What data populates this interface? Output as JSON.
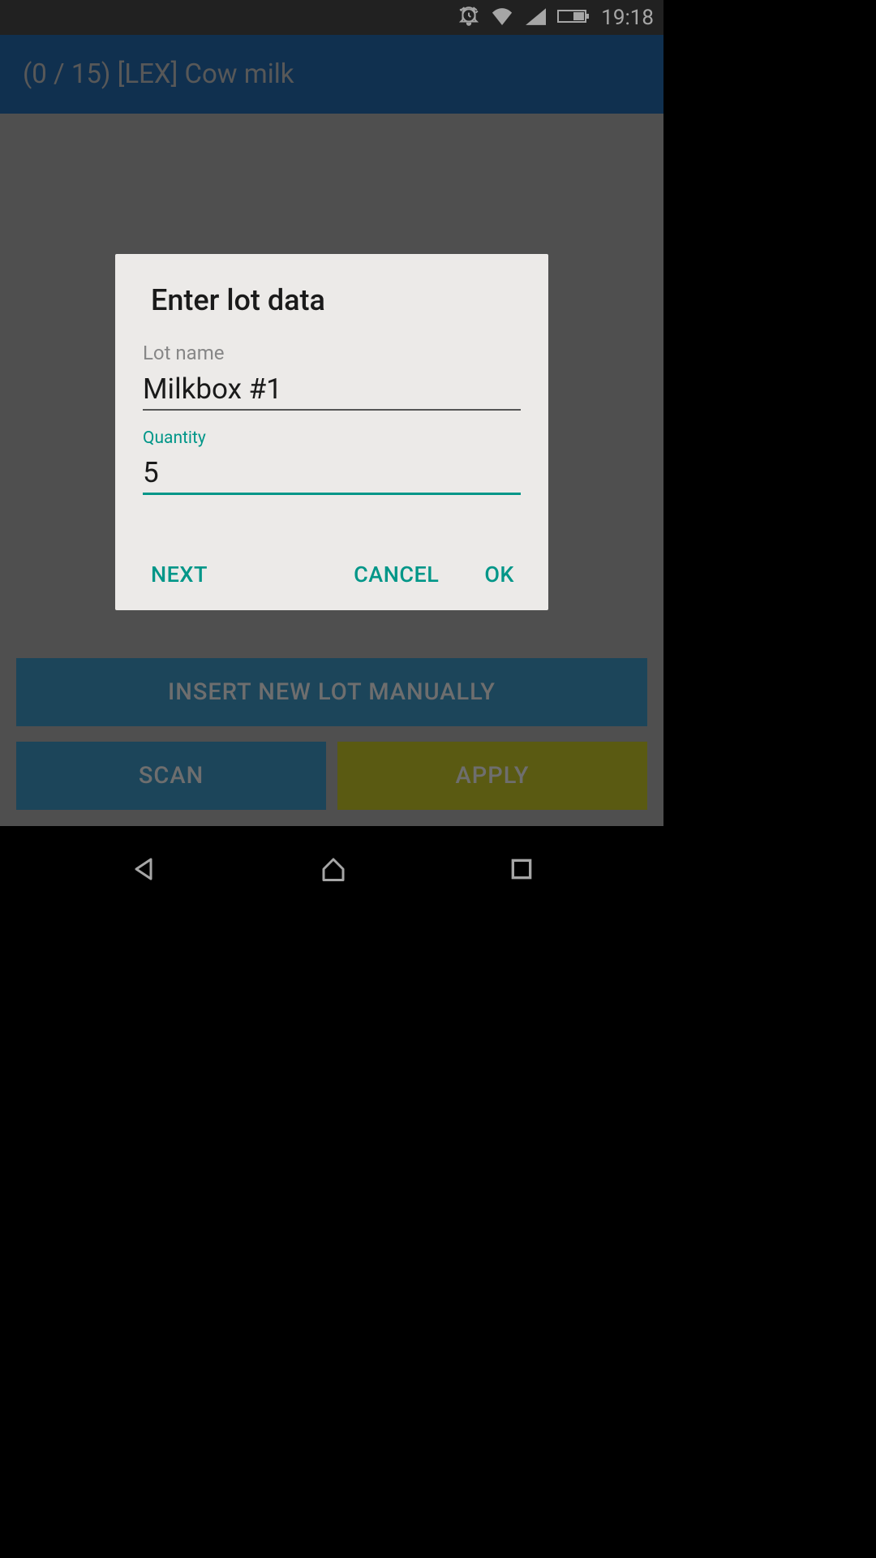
{
  "statusBar": {
    "time": "19:18",
    "icons": {
      "alarm": "alarm-icon",
      "wifi": "wifi-icon",
      "cell": "cell-signal-icon",
      "battery": "battery-icon"
    }
  },
  "header": {
    "title": "(0 / 15)  [LEX] Cow milk"
  },
  "buttons": {
    "insert": "INSERT NEW LOT MANUALLY",
    "scan": "SCAN",
    "apply": "APPLY"
  },
  "dialog": {
    "title": "Enter lot data",
    "lotNameLabel": "Lot name",
    "lotNameValue": "Milkbox #1",
    "quantityLabel": "Quantity",
    "quantityValue": "5",
    "nextLabel": "NEXT",
    "cancelLabel": "CANCEL",
    "okLabel": "OK"
  },
  "colors": {
    "teal": "#009688",
    "headerBlue": "#1a4a7a",
    "buttonBlue": "#2c6a8a",
    "buttonOlive": "#8a8a1c"
  }
}
